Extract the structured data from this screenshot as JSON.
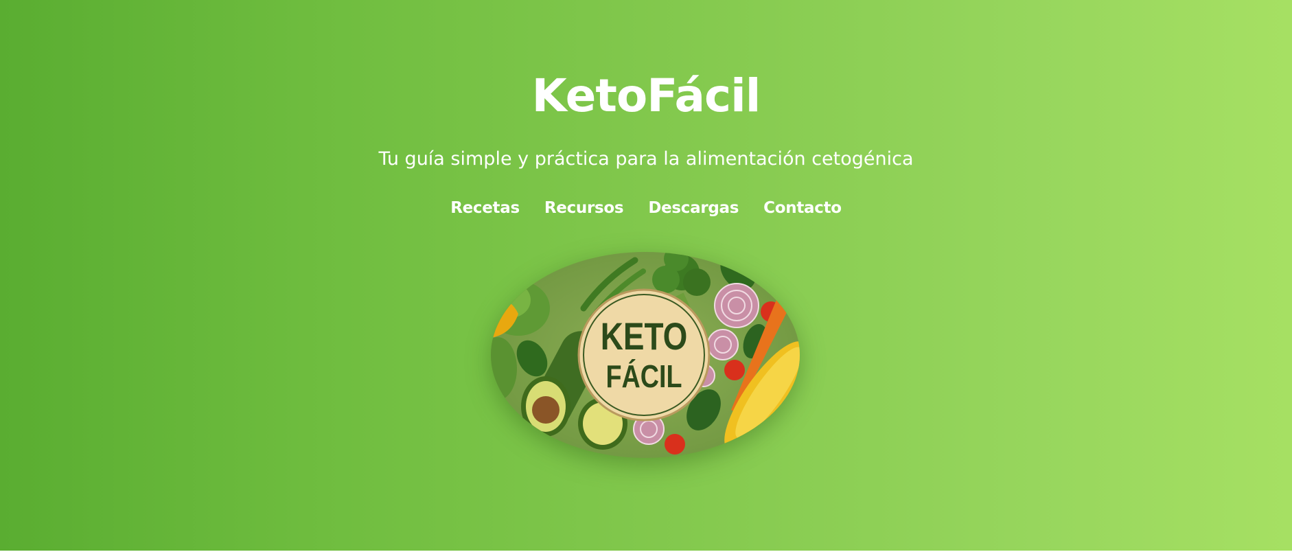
{
  "site": {
    "title": "KetoFácil",
    "tagline": "Tu guía simple y práctica para la alimentación cetogénica"
  },
  "nav": {
    "items": [
      {
        "label": "Recetas"
      },
      {
        "label": "Recursos"
      },
      {
        "label": "Descargas"
      },
      {
        "label": "Contacto"
      }
    ]
  },
  "logo": {
    "line1": "KETO",
    "line2": "FÁCIL"
  },
  "colors": {
    "gradient_start": "#5aad31",
    "gradient_end": "#a6e063",
    "logo_board": "#7fa44b",
    "badge_fill": "#efd9a6",
    "badge_text": "#2c4a1a"
  }
}
